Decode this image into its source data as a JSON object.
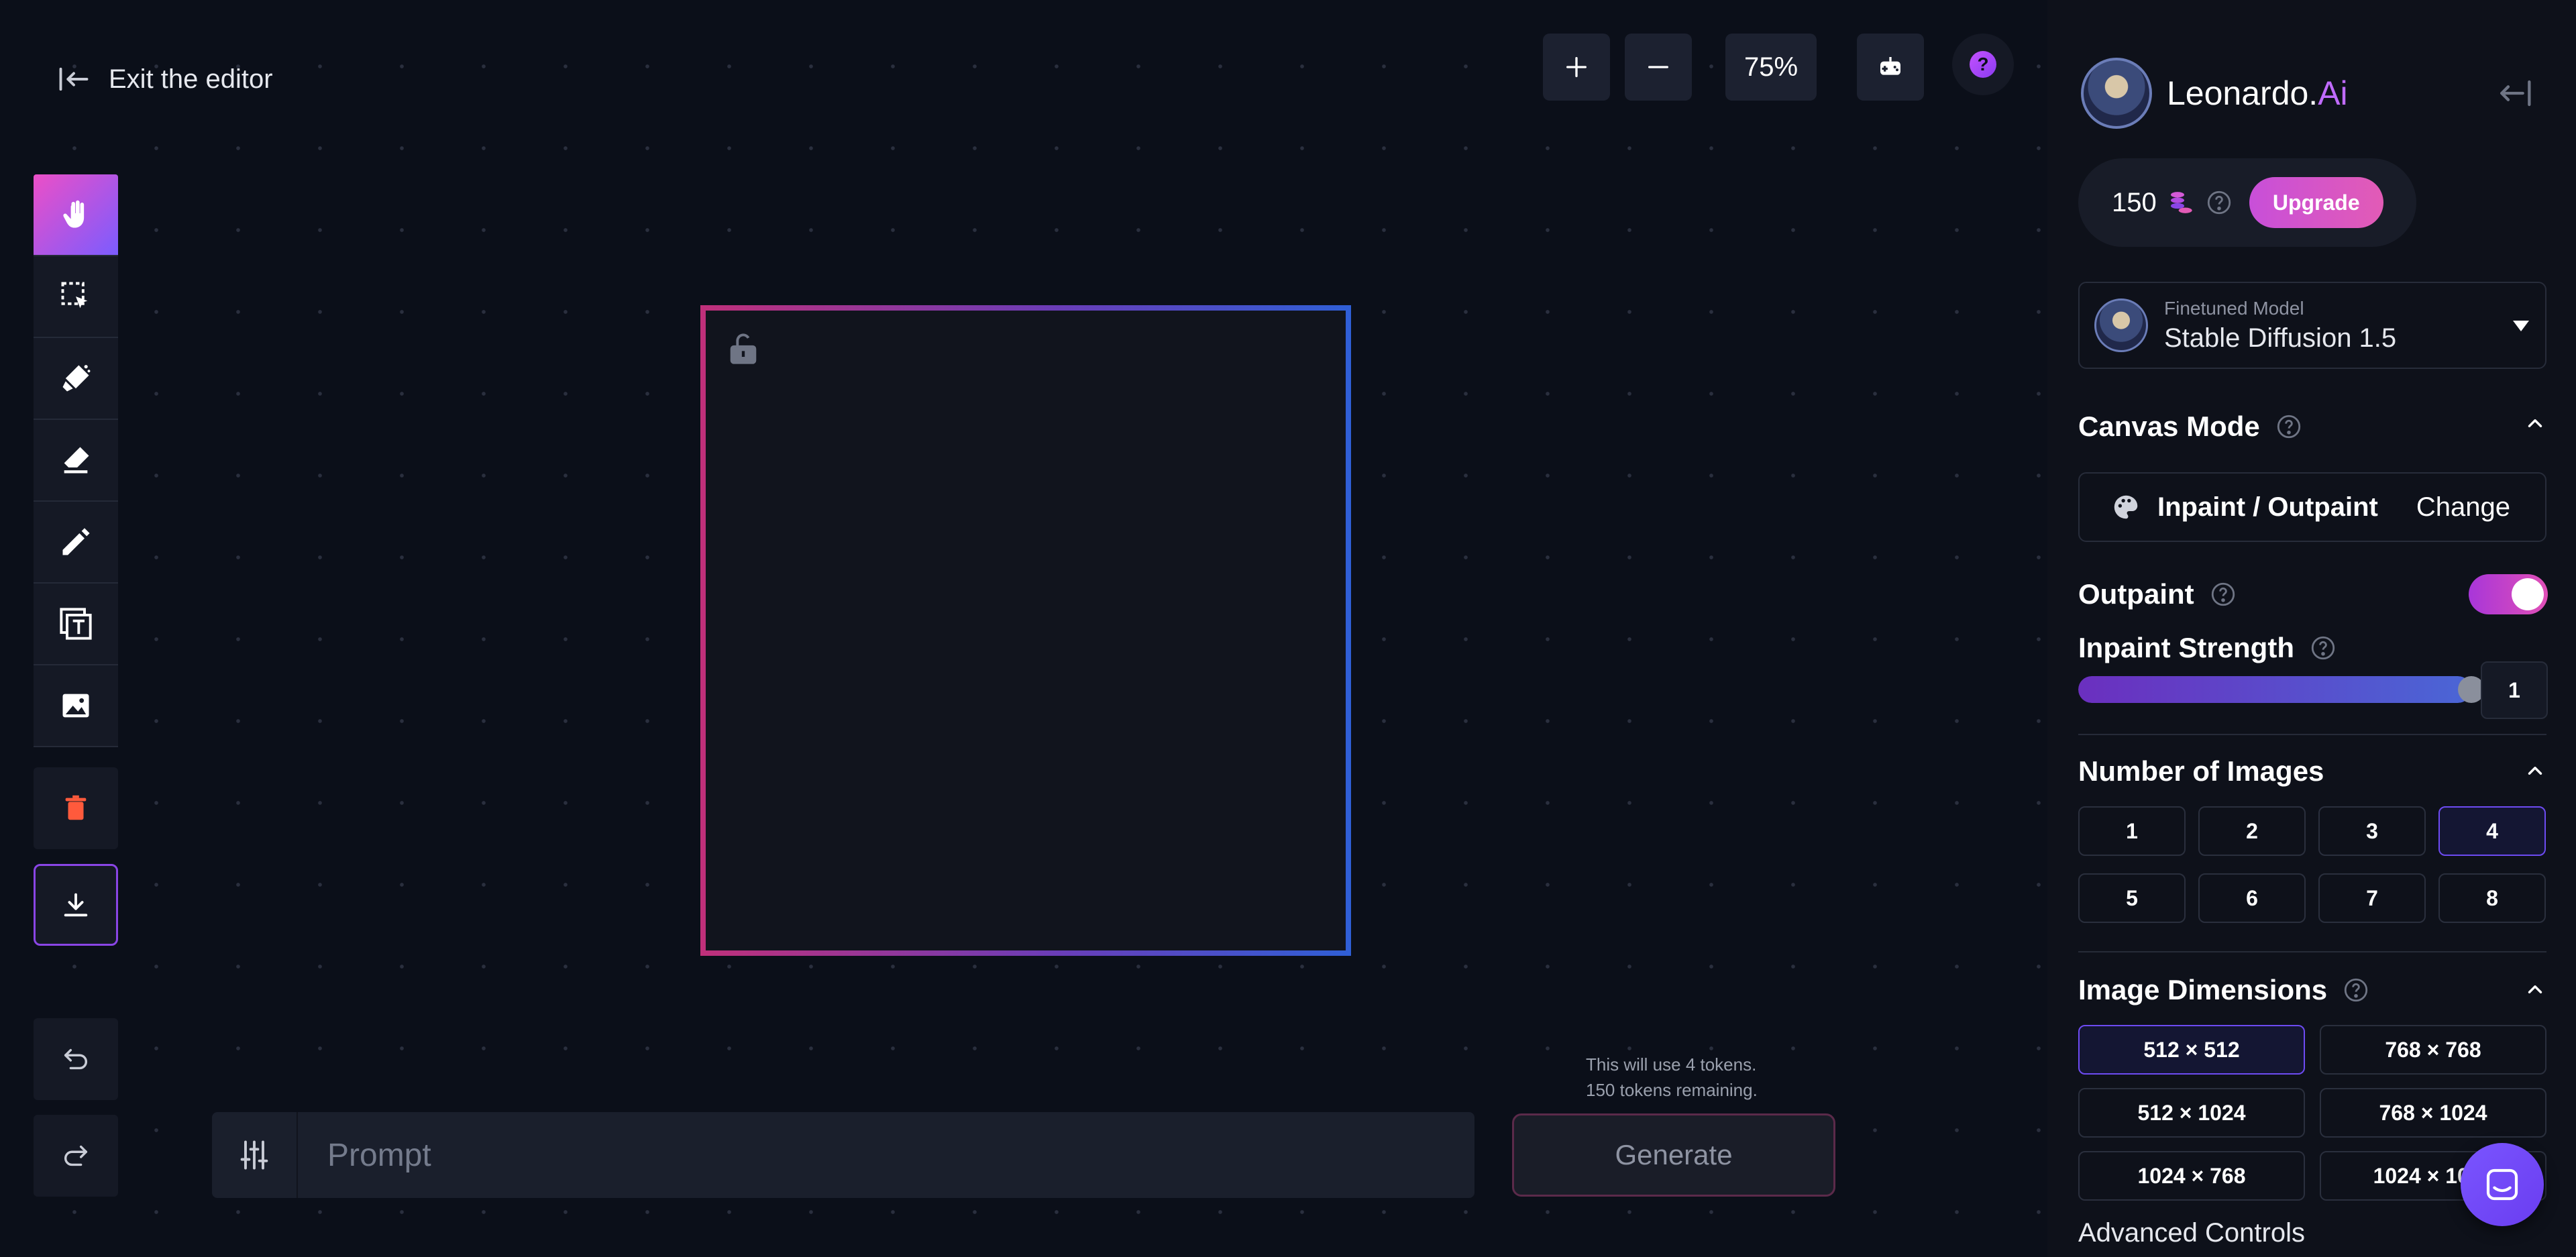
{
  "header": {
    "exit_label": "Exit the editor"
  },
  "zoom": {
    "plus_icon": "plus-icon",
    "minus_icon": "minus-icon",
    "level": "75%"
  },
  "toolbar": {
    "tools": [
      "pan-hand-icon",
      "select-icon",
      "draw-mask-icon",
      "eraser-icon",
      "pencil-icon",
      "text-icon",
      "image-icon"
    ],
    "delete_icon": "trash-icon",
    "download_icon": "download-icon",
    "undo_icon": "undo-icon",
    "redo_icon": "redo-icon"
  },
  "prompt": {
    "placeholder": "Prompt",
    "value": ""
  },
  "tokens": {
    "line1": "This will use 4 tokens.",
    "line2": "150 tokens remaining."
  },
  "generate_label": "Generate",
  "panel": {
    "brand_name": "Leonardo.",
    "brand_suffix": "Ai",
    "credits": "150",
    "upgrade_label": "Upgrade",
    "model": {
      "label": "Finetuned Model",
      "value": "Stable Diffusion 1.5"
    },
    "canvas_mode": {
      "title": "Canvas Mode",
      "value": "Inpaint / Outpaint",
      "change_label": "Change"
    },
    "outpaint": {
      "label": "Outpaint",
      "enabled": true
    },
    "inpaint_strength": {
      "label": "Inpaint Strength",
      "value": "1",
      "fraction": 1.0
    },
    "num_images": {
      "title": "Number of Images",
      "options": [
        "1",
        "2",
        "3",
        "4",
        "5",
        "6",
        "7",
        "8"
      ],
      "selected": "4"
    },
    "dimensions": {
      "title": "Image Dimensions",
      "options": [
        "512 × 512",
        "768 × 768",
        "512 × 1024",
        "768 × 1024",
        "1024 × 768",
        "1024 × 1024"
      ],
      "selected": "512 × 512"
    },
    "advanced_label": "Advanced Controls"
  },
  "colors": {
    "background": "#0b0f19",
    "accent_pink": "#e14fb6",
    "accent_purple": "#7b5cff",
    "brand_ai": "#c06bff"
  }
}
